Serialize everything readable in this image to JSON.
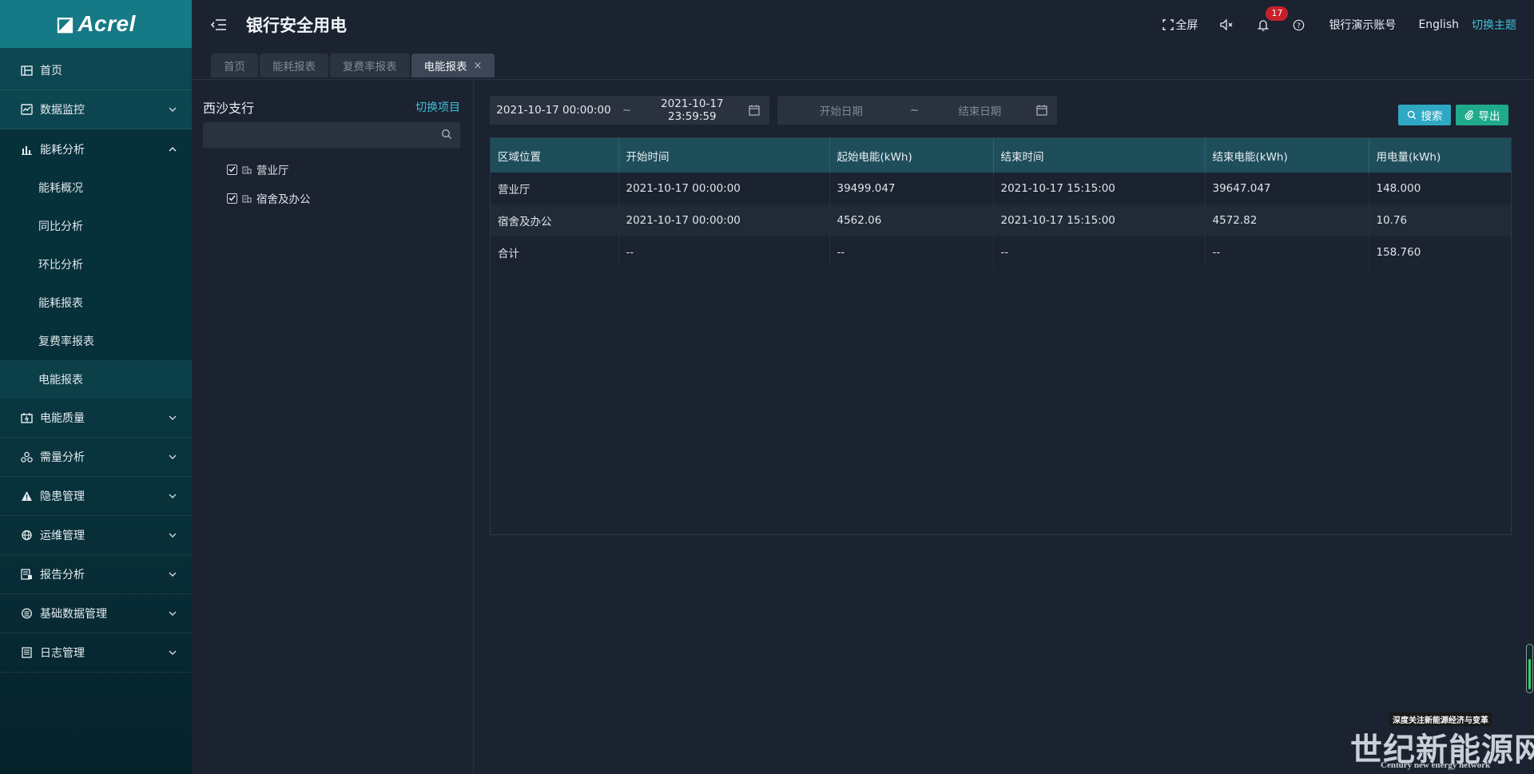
{
  "app": {
    "logo_text": "Acrel",
    "logo_mark": "◪",
    "title": "银行安全用电"
  },
  "header": {
    "fullscreen": "全屏",
    "notification_count": "17",
    "account": "银行演示账号",
    "language": "English",
    "theme": "切换主题"
  },
  "sidebar": {
    "items": [
      {
        "label": "首页",
        "icon": "home-icon"
      },
      {
        "label": "数据监控",
        "icon": "monitor-icon"
      },
      {
        "label": "能耗分析",
        "icon": "bar-chart-icon"
      },
      {
        "label": "电能质量",
        "icon": "power-quality-icon"
      },
      {
        "label": "需量分析",
        "icon": "demand-icon"
      },
      {
        "label": "隐患管理",
        "icon": "warning-icon"
      },
      {
        "label": "运维管理",
        "icon": "maintenance-icon"
      },
      {
        "label": "报告分析",
        "icon": "report-icon"
      },
      {
        "label": "基础数据管理",
        "icon": "database-icon"
      },
      {
        "label": "日志管理",
        "icon": "log-icon"
      }
    ],
    "submenu": [
      "能耗概况",
      "同比分析",
      "环比分析",
      "能耗报表",
      "复费率报表",
      "电能报表"
    ]
  },
  "tabs": [
    "首页",
    "能耗报表",
    "复费率报表",
    "电能报表"
  ],
  "tab_close": "×",
  "tree": {
    "title": "西沙支行",
    "switch_label": "切换项目",
    "search_placeholder": "",
    "nodes": [
      "营业厅",
      "宿舍及办公"
    ]
  },
  "filters": {
    "range1_start": "2021-10-17 00:00:00",
    "range1_end": "2021-10-17 23:59:59",
    "range2_start_placeholder": "开始日期",
    "range2_end_placeholder": "结束日期",
    "separator": "~",
    "search_button": "搜索",
    "export_button": "导出"
  },
  "table": {
    "headers": [
      "区域位置",
      "开始时间",
      "起始电能(kWh)",
      "结束时间",
      "结束电能(kWh)",
      "用电量(kWh)"
    ],
    "rows": [
      [
        "营业厅",
        "2021-10-17 00:00:00",
        "39499.047",
        "2021-10-17 15:15:00",
        "39647.047",
        "148.000"
      ],
      [
        "宿舍及办公",
        "2021-10-17 00:00:00",
        "4562.06",
        "2021-10-17 15:15:00",
        "4572.82",
        "10.76"
      ],
      [
        "合计",
        "--",
        "--",
        "--",
        "--",
        "158.760"
      ]
    ]
  },
  "watermark": {
    "tag": "深度关注新能源经济与变革",
    "main": "世纪新能源网",
    "sub": "Century new energy network"
  },
  "colors": {
    "accent": "#3fc0d6",
    "search_button": "#2fa8c4",
    "export_button": "#1fab8b",
    "badge": "#c8202b",
    "table_header": "#1f4e5b"
  }
}
